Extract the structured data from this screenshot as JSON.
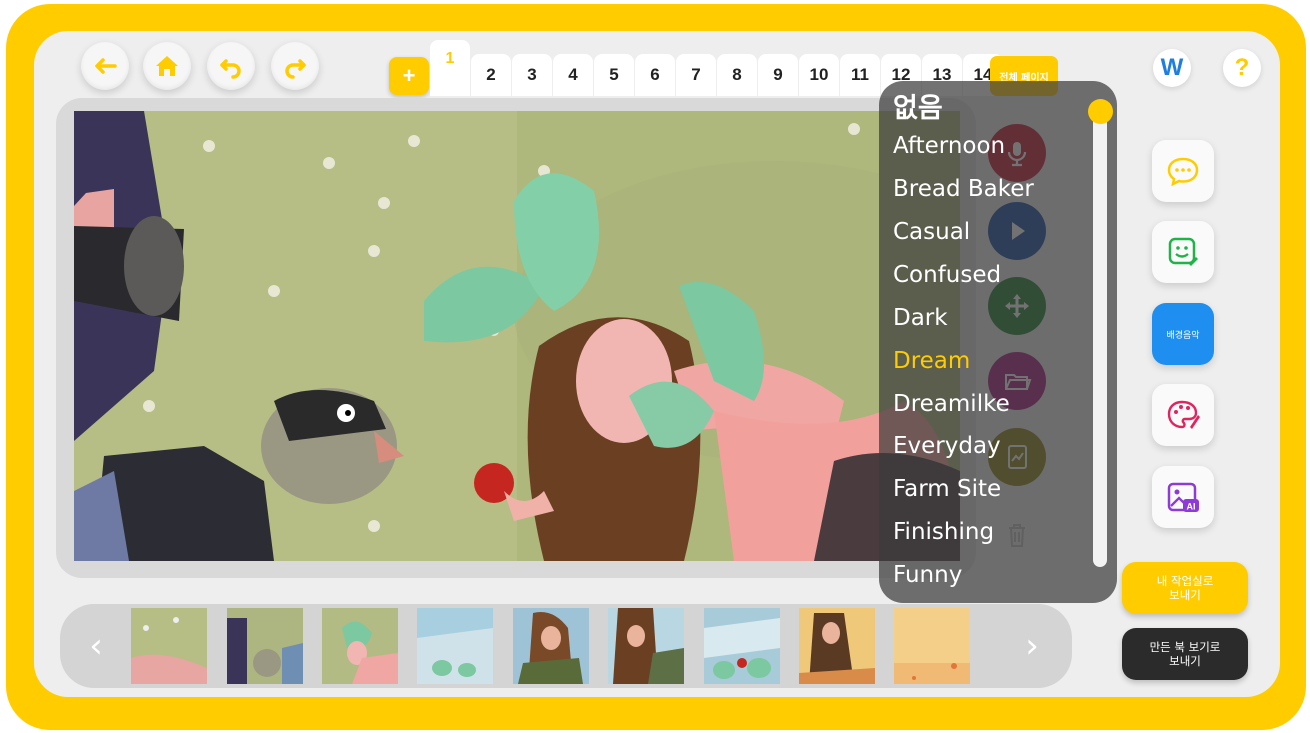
{
  "toolbar": {
    "back_icon": "arrow-left-icon",
    "home_icon": "home-icon",
    "undo_icon": "undo-icon",
    "redo_icon": "redo-icon",
    "add_page_label": "+",
    "pages": [
      "1",
      "2",
      "3",
      "4",
      "5",
      "6",
      "7",
      "8",
      "9",
      "10",
      "11",
      "12",
      "13",
      "14"
    ],
    "active_page": "1",
    "all_pages_label": "전체 페이지",
    "w_label": "W",
    "help_label": "?"
  },
  "side_tools": {
    "speech_icon": "speech-bubble-icon",
    "sticker_icon": "smiley-edit-icon",
    "bgm_label": "배경음악",
    "paint_icon": "palette-icon",
    "ai_image_icon": "ai-image-icon"
  },
  "actions": {
    "send_workroom": "내 작업실로\n보내기",
    "send_bookview": "만든 북 보기로\n보내기"
  },
  "thumbnails": {
    "prev": "‹",
    "next": "›",
    "count": 9
  },
  "music_menu": {
    "none_label": "없음",
    "items": [
      "Afternoon",
      "Bread Baker",
      "Casual",
      "Confused",
      "Dark",
      "Dream",
      "Dreamilke",
      "Everyday",
      "Farm Site",
      "Finishing",
      "Funny"
    ],
    "selected": "Dream"
  },
  "colors": {
    "brand_yellow": "#ffcc00",
    "panel_gray": "#eeeeee",
    "bgm_blue": "#1e8ff0",
    "mic_red": "#c8102e",
    "play_blue": "#0d47a1",
    "move_green": "#1b7a2a",
    "open_magenta": "#a0157a",
    "notebook_olive": "#8a7a10"
  }
}
